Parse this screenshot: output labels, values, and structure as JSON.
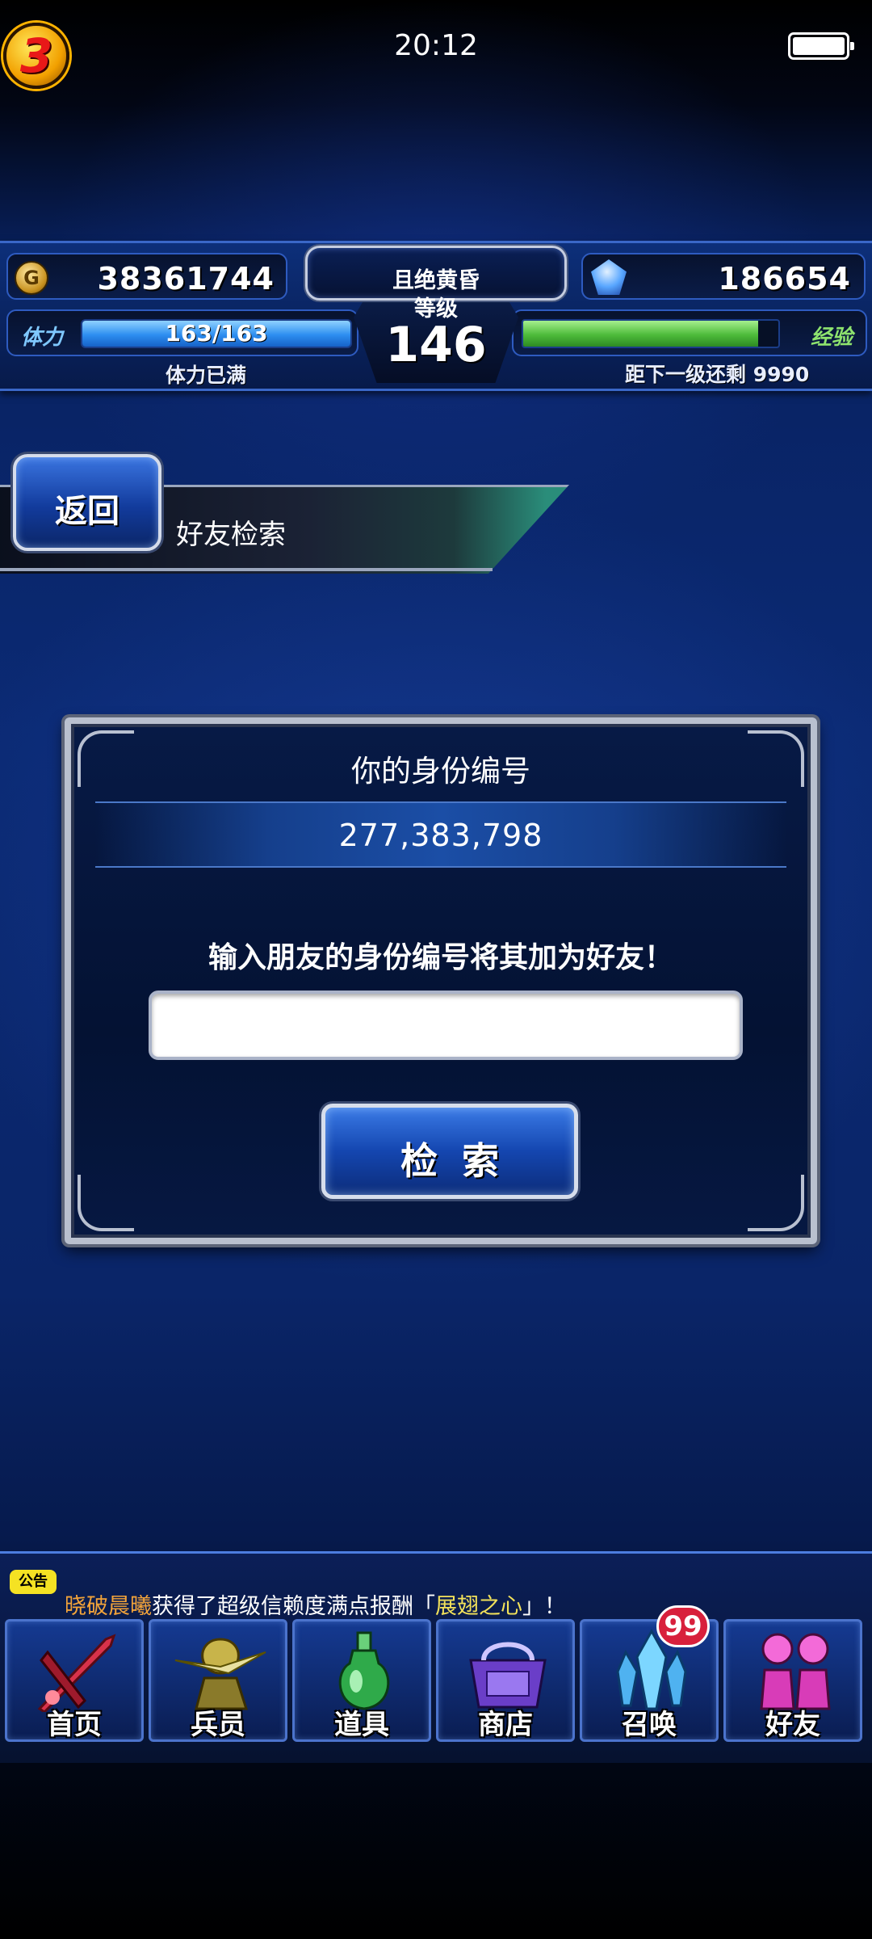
{
  "status_bar": {
    "time": "20:12",
    "app_badge": "3"
  },
  "resources": {
    "gil": "38361744",
    "gems": "186654",
    "player_title": "且绝黄昏",
    "level_label": "等级",
    "level": "146",
    "stamina_label": "体力",
    "stamina_value": "163/163",
    "stamina_fraction": 1.0,
    "stamina_status": "体力已满",
    "exp_label": "经验",
    "exp_fraction": 0.92,
    "exp_remaining": "距下一级还剩 9990"
  },
  "header": {
    "back_label": "返回",
    "title": "好友检索"
  },
  "dialog": {
    "heading": "你的身份编号",
    "my_id": "277,383,798",
    "prompt": "输入朋友的身份编号将其加为好友！",
    "input_value": "",
    "search_label": "检索"
  },
  "notice": {
    "badge": "公告",
    "part1": "晓破晨曦",
    "part2": "获得了超级信赖度满点报酬「",
    "part3": "展翅之心",
    "part4": "」！"
  },
  "nav": {
    "items": [
      {
        "label": "首页",
        "icon": "sword-icon"
      },
      {
        "label": "兵员",
        "icon": "unit-icon"
      },
      {
        "label": "道具",
        "icon": "potion-icon"
      },
      {
        "label": "商店",
        "icon": "shop-icon"
      },
      {
        "label": "召唤",
        "icon": "crystal-icon"
      },
      {
        "label": "好友",
        "icon": "friends-icon"
      }
    ],
    "summon_badge": "99"
  }
}
